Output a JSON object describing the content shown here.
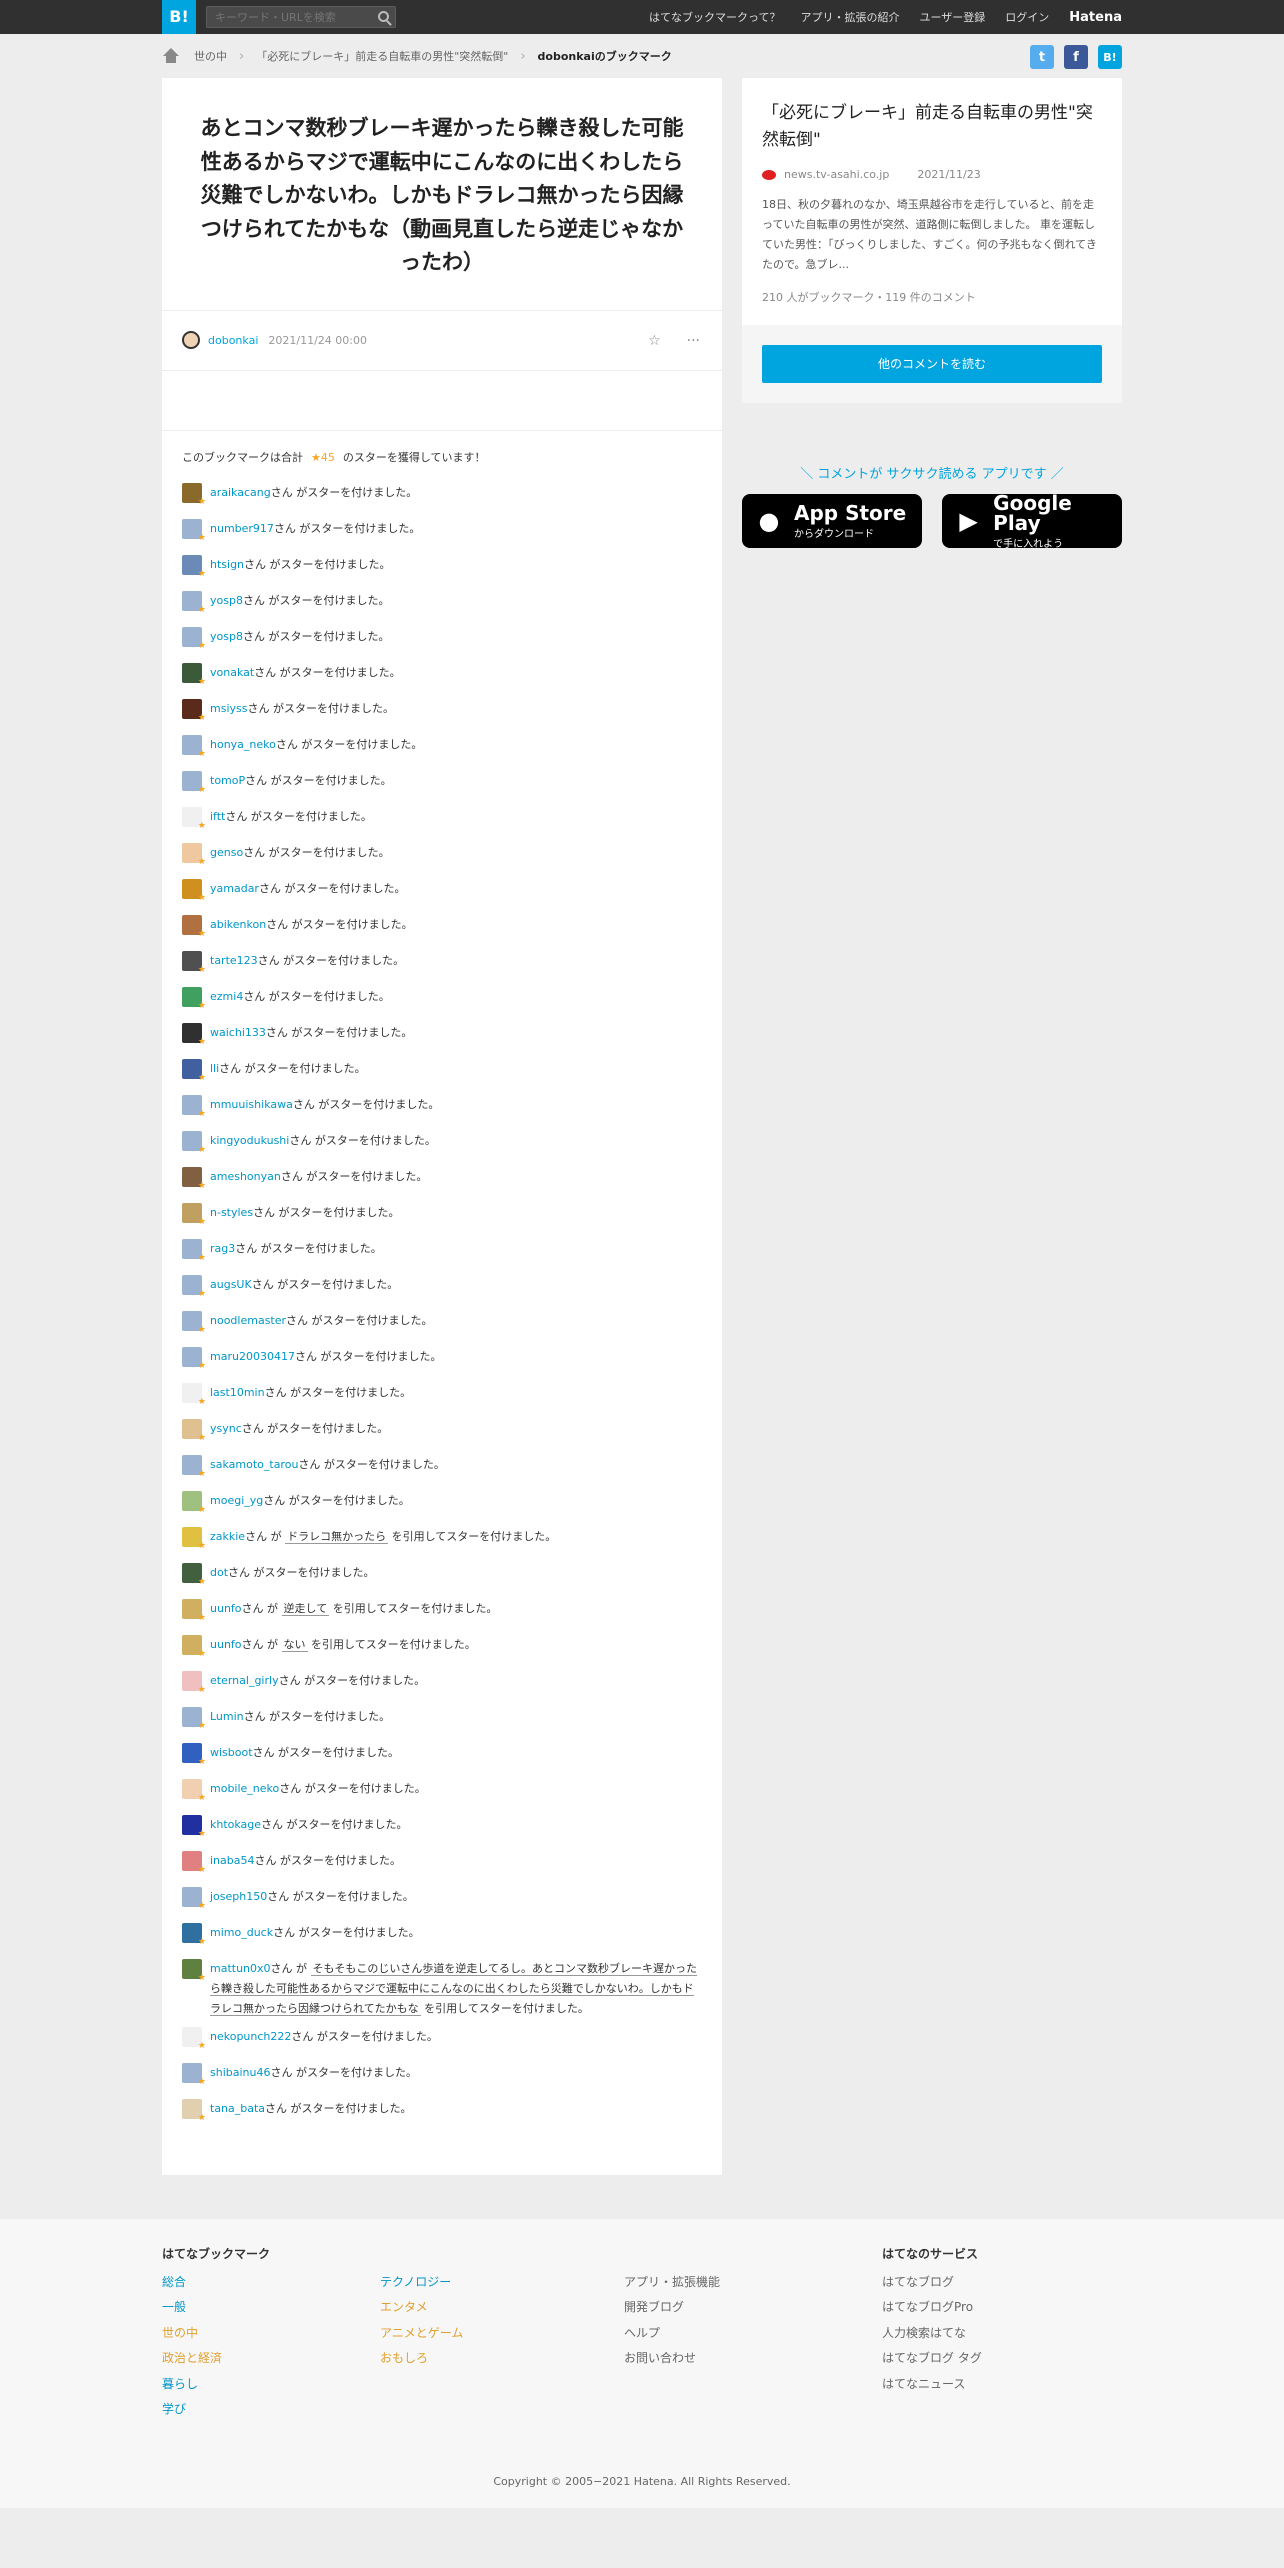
{
  "header": {
    "logo": "B!",
    "search_placeholder": "キーワード・URLを検索",
    "nav": [
      "はてなブックマークって？",
      "アプリ・拡張の紹介",
      "ユーザー登録",
      "ログイン"
    ],
    "brand": "Hatena"
  },
  "breadcrumb": {
    "items": [
      "世の中",
      "「必死にブレーキ」前走る自転車の男性\"突然転倒\""
    ],
    "current": "dobonkaiのブックマーク"
  },
  "share": {
    "twitter": "t",
    "facebook": "f",
    "hatena": "B!"
  },
  "entry": {
    "title": "あとコンマ数秒ブレーキ遅かったら轢き殺した可能性あるからマジで運転中にこんなのに出くわしたら災難でしかないわ。しかもドラレコ無かったら因縁つけられてたかもな（動画見直したら逆走じゃなかったわ）",
    "user": "dobonkai",
    "date": "2021/11/24 00:00",
    "star_icon": "☆",
    "more_icon": "···"
  },
  "stars": {
    "summary_prefix": "このブックマークは合計",
    "total": "★45",
    "summary_suffix": "のスターを獲得しています！",
    "suffix": "さん がスターを付けました。",
    "quote_mid": "さん が",
    "quote_end": "を引用してスターを付けました。",
    "users": [
      {
        "name": "araikacang",
        "color": "#8a6a2a"
      },
      {
        "name": "number917",
        "color": "#9bb2d0"
      },
      {
        "name": "htsign",
        "color": "#6a8ab8"
      },
      {
        "name": "yosp8",
        "color": "#9bb2d0"
      },
      {
        "name": "yosp8",
        "color": "#9bb2d0"
      },
      {
        "name": "vonakat",
        "color": "#3a5a3a"
      },
      {
        "name": "msiyss",
        "color": "#5a2a1a"
      },
      {
        "name": "honya_neko",
        "color": "#9bb2d0"
      },
      {
        "name": "tomoP",
        "color": "#9bb2d0"
      },
      {
        "name": "iftt",
        "color": "#f0f0f0"
      },
      {
        "name": "genso",
        "color": "#f0c8a0"
      },
      {
        "name": "yamadar",
        "color": "#d09020"
      },
      {
        "name": "abikenkon",
        "color": "#b07040"
      },
      {
        "name": "tarte123",
        "color": "#505050"
      },
      {
        "name": "ezmi4",
        "color": "#40a060"
      },
      {
        "name": "waichi133",
        "color": "#303030"
      },
      {
        "name": "lli",
        "color": "#4060a0"
      },
      {
        "name": "mmuuishikawa",
        "color": "#9bb2d0"
      },
      {
        "name": "kingyodukushi",
        "color": "#9bb2d0"
      },
      {
        "name": "ameshonyan",
        "color": "#806040"
      },
      {
        "name": "n-styles",
        "color": "#c0a060"
      },
      {
        "name": "rag3",
        "color": "#9bb2d0"
      },
      {
        "name": "augsUK",
        "color": "#9bb2d0"
      },
      {
        "name": "noodlemaster",
        "color": "#9bb2d0"
      },
      {
        "name": "maru20030417",
        "color": "#9bb2d0"
      },
      {
        "name": "last10min",
        "color": "#f0f0f0"
      },
      {
        "name": "ysync",
        "color": "#e0c090"
      },
      {
        "name": "sakamoto_tarou",
        "color": "#9bb2d0"
      },
      {
        "name": "moegi_yg",
        "color": "#a0c080"
      },
      {
        "name": "zakkie",
        "color": "#e0c040",
        "quote": "ドラレコ無かったら"
      },
      {
        "name": "dot",
        "color": "#406040"
      },
      {
        "name": "uunfo",
        "color": "#d0b060",
        "quote": "逆走して"
      },
      {
        "name": "uunfo",
        "color": "#d0b060",
        "quote": "ない"
      },
      {
        "name": "eternal_girly",
        "color": "#f0c0c0"
      },
      {
        "name": "Lumin",
        "color": "#9bb2d0"
      },
      {
        "name": "wisboot",
        "color": "#3060c0"
      },
      {
        "name": "mobile_neko",
        "color": "#f0d0b0"
      },
      {
        "name": "khtokage",
        "color": "#2030a0"
      },
      {
        "name": "inaba54",
        "color": "#e08080"
      },
      {
        "name": "joseph150",
        "color": "#9bb2d0"
      },
      {
        "name": "mimo_duck",
        "color": "#3070a0"
      },
      {
        "name": "mattun0x0",
        "color": "#608040",
        "quote": "そもそもこのじいさん歩道を逆走してるし。あとコンマ数秒ブレーキ遅かったら轢き殺した可能性あるからマジで運転中にこんなのに出くわしたら災難でしかないわ。しかもドラレコ無かったら因縁つけられてたかもな"
      },
      {
        "name": "nekopunch222",
        "color": "#f0f0f0"
      },
      {
        "name": "shibainu46",
        "color": "#9bb2d0"
      },
      {
        "name": "tana_bata",
        "color": "#e0d0b0"
      }
    ]
  },
  "sidebar": {
    "title": "「必死にブレーキ」前走る自転車の男性\"突然転倒\"",
    "source": "news.tv-asahi.co.jp",
    "date": "2021/11/23",
    "description": "18日、秋の夕暮れのなか、埼玉県越谷市を走行していると、前を走っていた自転車の男性が突然、道路側に転倒しました。 車を運転していた男性：「びっくりしました、すごく。何の予兆もなく倒れてきたので。急ブレ...",
    "counts": "210 人がブックマーク・119 件のコメント",
    "read_button": "他のコメントを読む",
    "promo": "＼ コメントが サクサク読める アプリです ／",
    "app_store_big": "App Store",
    "app_store_small": "からダウンロード",
    "google_big": "Google Play",
    "google_small": "で手に入れよう"
  },
  "footer": {
    "col1_title": "はてなブックマーク",
    "col1a": [
      "総合",
      "一般",
      "世の中",
      "政治と経済",
      "暮らし",
      "学び"
    ],
    "col1b": [
      "テクノロジー",
      "エンタメ",
      "アニメとゲーム",
      "おもしろ"
    ],
    "col2": [
      "アプリ・拡張機能",
      "開発ブログ",
      "ヘルプ",
      "お問い合わせ"
    ],
    "col3_title": "はてなのサービス",
    "col3": [
      "はてなブログ",
      "はてなブログPro",
      "人力検索はてな",
      "はてなブログ タグ",
      "はてなニュース"
    ],
    "copyright": "Copyright © 2005−2021 Hatena. All Rights Reserved."
  }
}
